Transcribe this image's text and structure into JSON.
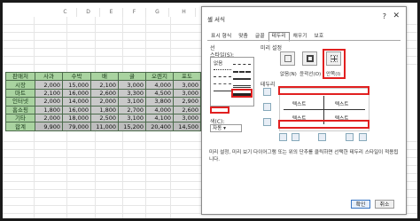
{
  "spreadsheet": {
    "columns": [
      "C",
      "D",
      "E",
      "F",
      "G",
      "H"
    ],
    "table": {
      "headers": [
        "판매처",
        "사과",
        "수박",
        "배",
        "귤",
        "오렌지",
        "포도"
      ],
      "rows": [
        {
          "label": "시장",
          "values": [
            "2,000",
            "15,000",
            "2,100",
            "3,000",
            "4,000",
            "3,000"
          ]
        },
        {
          "label": "마트",
          "values": [
            "2,100",
            "16,000",
            "2,600",
            "3,300",
            "4,500",
            "3,000"
          ]
        },
        {
          "label": "인터넷",
          "values": [
            "2,000",
            "14,000",
            "2,000",
            "3,100",
            "3,800",
            "2,900"
          ]
        },
        {
          "label": "홈쇼핑",
          "values": [
            "1,800",
            "16,000",
            "1,800",
            "2,700",
            "4,000",
            "2,600"
          ]
        },
        {
          "label": "기타",
          "values": [
            "2,000",
            "18,000",
            "2,500",
            "3,100",
            "4,100",
            "3,000"
          ]
        },
        {
          "label": "합계",
          "values": [
            "9,900",
            "79,000",
            "11,000",
            "15,200",
            "20,400",
            "14,500"
          ]
        }
      ]
    }
  },
  "dialog": {
    "title": "셀 서식",
    "help": "?",
    "close": "✕",
    "tabs": [
      "표시 형식",
      "맞춤",
      "글꼴",
      "테두리",
      "채우기",
      "보호"
    ],
    "active_tab": "테두리",
    "line_section": "선",
    "style_label": "스타일(S):",
    "style_none": "없음",
    "color_label": "색(C):",
    "color_value": "자동",
    "presets_label": "미리 설정",
    "presets": [
      {
        "label": "없음(N)"
      },
      {
        "label": "윤곽선(O)"
      },
      {
        "label": "안쪽(I)"
      }
    ],
    "border_label": "테두리",
    "preview_text": "텍스트",
    "hint": "미리 설정, 미리 보기 다이어그램 또는 위의 단추를 클릭하면 선택한 테두리 스타일이 적용됩니다.",
    "ok": "확인",
    "cancel": "취소",
    "highlight_color": "#e12020"
  }
}
